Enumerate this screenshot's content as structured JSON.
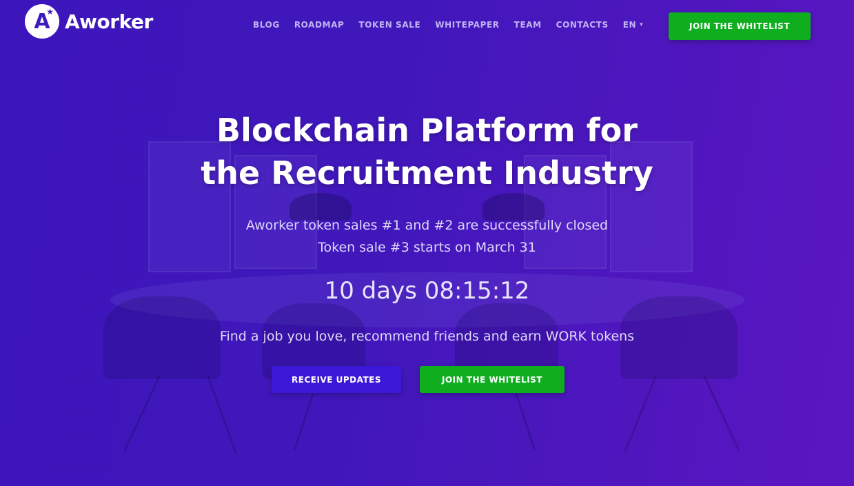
{
  "header": {
    "logo_text": "Aworker",
    "logo_letter": "A",
    "nav": [
      "BLOG",
      "ROADMAP",
      "TOKEN SALE",
      "WHITEPAPER",
      "TEAM",
      "CONTACTS"
    ],
    "language": "EN",
    "cta_label": "JOIN THE WHITELIST"
  },
  "hero": {
    "title_line1": "Blockchain Platform for",
    "title_line2": "the Recruitment Industry",
    "status_line1": "Aworker token sales #1 and #2 are successfully closed",
    "status_line2": "Token sale #3 starts on March 31",
    "countdown": "10 days 08:15:12",
    "tagline": "Find a job you love, recommend friends and earn WORK tokens",
    "receive_updates_label": "RECEIVE UPDATES",
    "join_whitelist_label": "JOIN THE WHITELIST"
  },
  "colors": {
    "primary_purple": "#3d1cc0",
    "accent_green": "#0fae1e",
    "button_blue": "#3c17d8"
  }
}
